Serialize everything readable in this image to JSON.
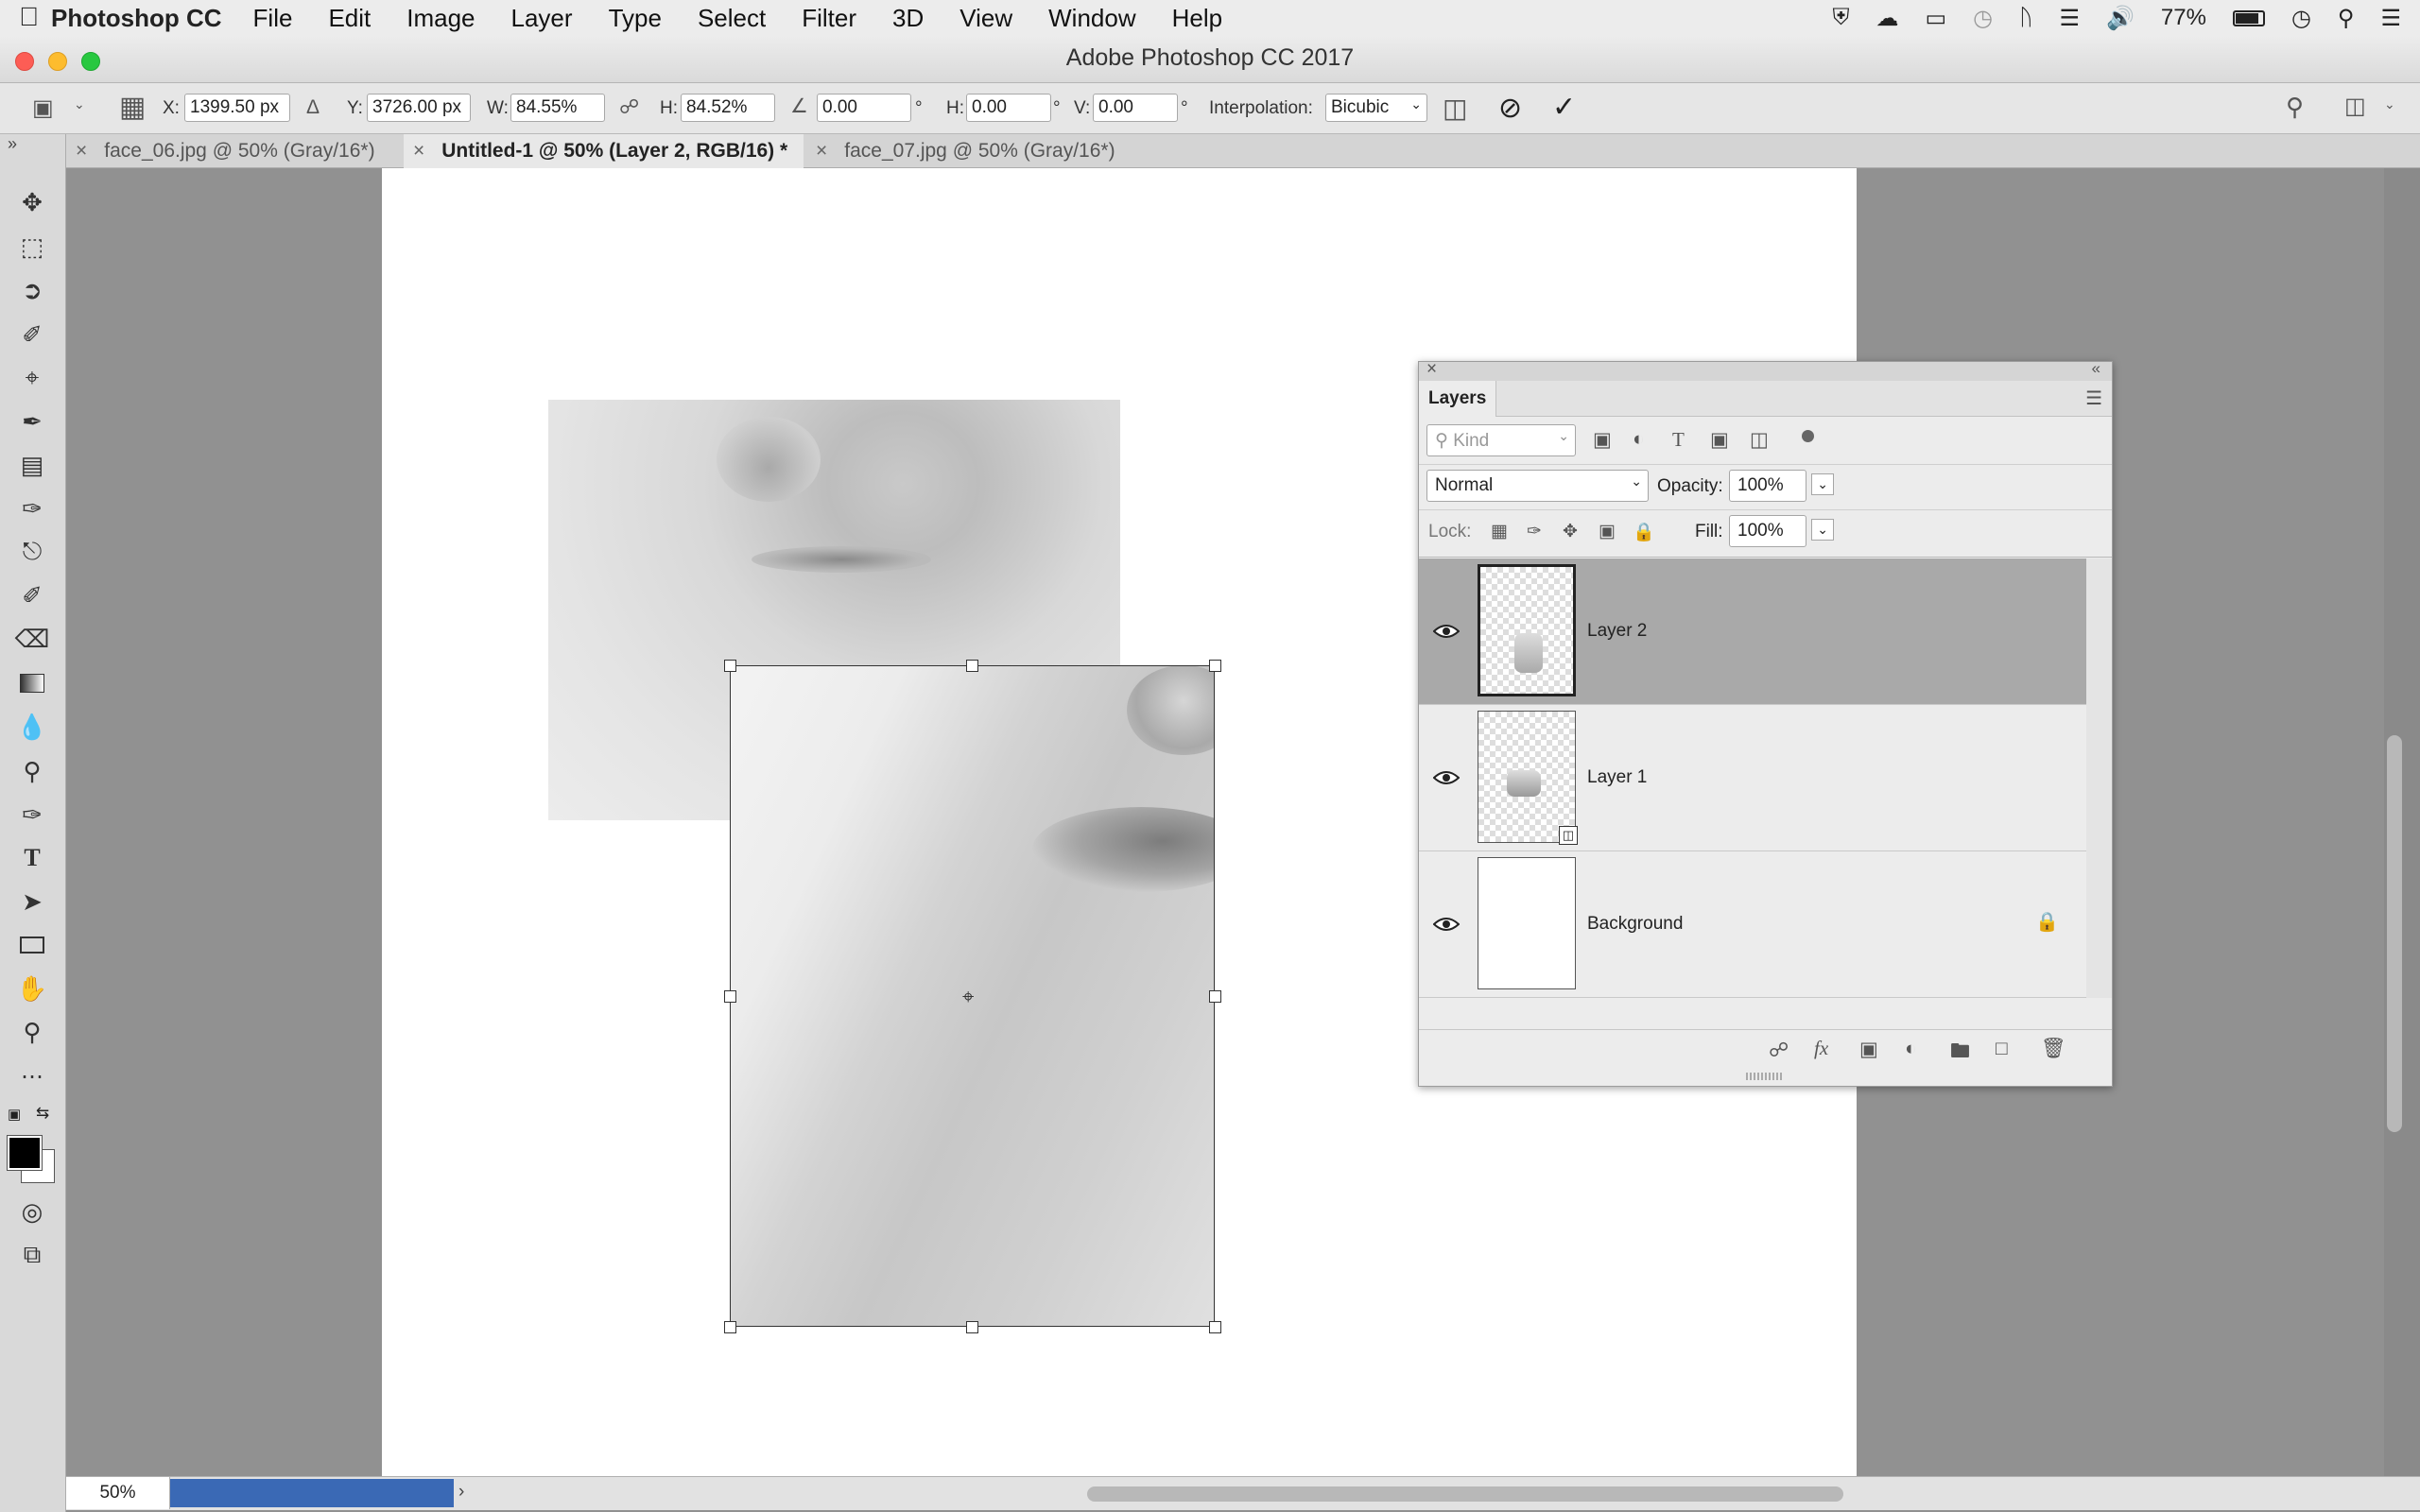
{
  "menubar": {
    "apple": "",
    "app_name": "Photoshop CC",
    "items": [
      "File",
      "Edit",
      "Image",
      "Layer",
      "Type",
      "Select",
      "Filter",
      "3D",
      "View",
      "Window",
      "Help"
    ],
    "battery": "77%"
  },
  "window": {
    "title": "Adobe Photoshop CC 2017"
  },
  "options": {
    "x_label": "X:",
    "x_value": "1399.50 px",
    "y_label": "Y:",
    "y_value": "3726.00 px",
    "w_label": "W:",
    "w_value": "84.55%",
    "h_label": "H:",
    "h_value": "84.52%",
    "angle_value": "0.00",
    "degree": "°",
    "hskew_label": "H:",
    "hskew_value": "0.00",
    "vskew_label": "V:",
    "vskew_value": "0.00",
    "interp_label": "Interpolation:",
    "interp_value": "Bicubic"
  },
  "tabs": [
    {
      "label": "face_06.jpg @ 50% (Gray/16*)"
    },
    {
      "label": "Untitled-1 @ 50% (Layer 2, RGB/16) *",
      "active": true
    },
    {
      "label": "face_07.jpg @ 50% (Gray/16*)"
    }
  ],
  "layers_panel": {
    "title": "Layers",
    "filter_kind": "Kind",
    "blend_mode": "Normal",
    "opacity_label": "Opacity:",
    "opacity_value": "100%",
    "lock_label": "Lock:",
    "fill_label": "Fill:",
    "fill_value": "100%",
    "layers": [
      {
        "name": "Layer 2",
        "selected": true
      },
      {
        "name": "Layer 1",
        "smart_object": true
      },
      {
        "name": "Background",
        "locked": true
      }
    ]
  },
  "status": {
    "zoom": "50%"
  },
  "colors": {
    "selection_row": "#a9a9a9",
    "status_progress": "#3a69b5"
  }
}
